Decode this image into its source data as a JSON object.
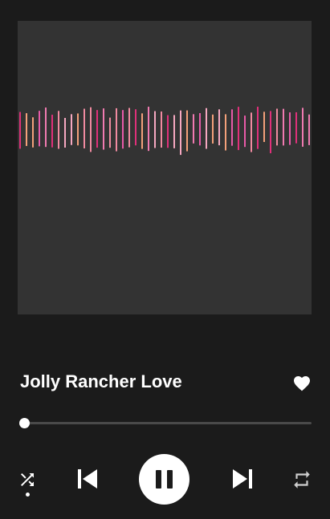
{
  "track": {
    "title": "Jolly Rancher Love",
    "liked": true
  },
  "playback": {
    "progress_fraction": 0.0,
    "is_playing": true,
    "shuffle_active": true
  },
  "controls": {
    "shuffle_icon": "shuffle-icon",
    "previous_icon": "skip-previous-icon",
    "pause_icon": "pause-icon",
    "next_icon": "skip-next-icon",
    "repeat_icon": "repeat-icon",
    "like_icon": "heart-icon"
  },
  "artwork": {
    "background": "#333333",
    "bar_colors": [
      "#e0307a",
      "#f08aa0",
      "#f07ab0",
      "#f4a07a",
      "#e85aa8",
      "#f6a8c0"
    ]
  }
}
